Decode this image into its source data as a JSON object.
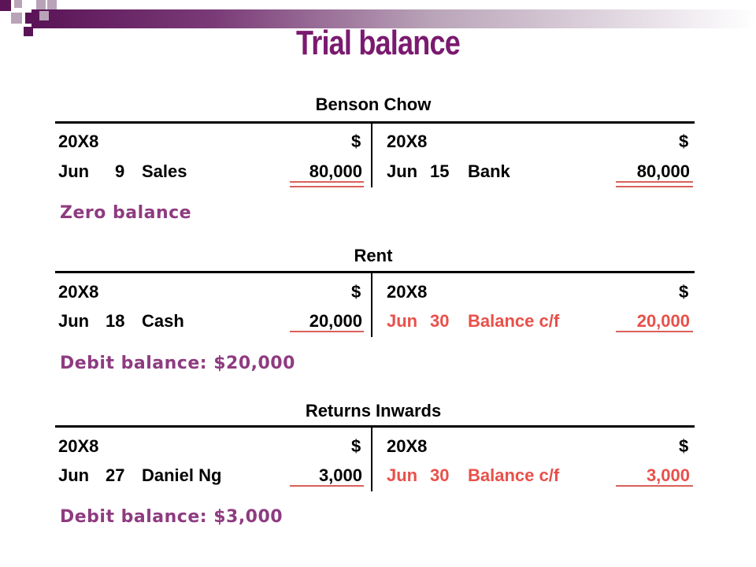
{
  "title": "Trial balance",
  "colors": {
    "title": "#7a1a6f",
    "note": "#8e3b80",
    "red": "#e8504a",
    "underline": "#d9605a"
  },
  "accounts": [
    {
      "name": "Benson Chow",
      "left": {
        "year": "20X8",
        "cur": "$",
        "month": "Jun",
        "day": "9",
        "desc": "Sales",
        "amount": "80,000"
      },
      "right": {
        "year": "20X8",
        "cur": "$",
        "month": "Jun",
        "day": "15",
        "desc": "Bank",
        "amount": "80,000"
      },
      "note": "Zero balance"
    },
    {
      "name": "Rent",
      "left": {
        "year": "20X8",
        "cur": "$",
        "month": "Jun",
        "day": "18",
        "desc": "Cash",
        "amount": "20,000"
      },
      "right": {
        "year": "20X8",
        "cur": "$",
        "month": "Jun",
        "day": "30",
        "desc": "Balance c/f",
        "amount": "20,000"
      },
      "note": "Debit balance: $20,000"
    },
    {
      "name": "Returns Inwards",
      "left": {
        "year": "20X8",
        "cur": "$",
        "month": "Jun",
        "day": "27",
        "desc": "Daniel Ng",
        "amount": "3,000"
      },
      "right": {
        "year": "20X8",
        "cur": "$",
        "month": "Jun",
        "day": "30",
        "desc": "Balance c/f",
        "amount": "3,000"
      },
      "note": "Debit balance: $3,000"
    }
  ]
}
